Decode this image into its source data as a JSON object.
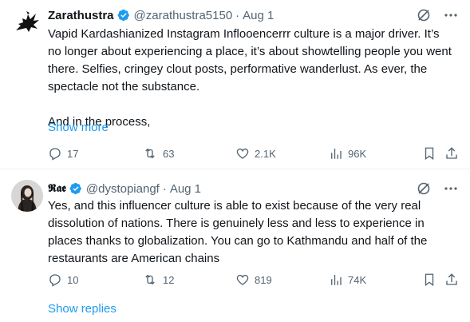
{
  "tweets": [
    {
      "name": "Zarathustra",
      "handle": "@zarathustra5150",
      "separator": "·",
      "date": "Aug 1",
      "body": [
        "Vapid Kardashianized Instagram Inflooencerrr  culture is a major driver. It’s no longer about experiencing a place, it’s about showtelling people you went there. Selfies, cringey clout posts, performative wanderlust. As ever, the spectacle not the substance.",
        "And in the process,"
      ],
      "show_more": "Show more",
      "stats": {
        "replies": "17",
        "retweets": "63",
        "likes": "2.1K",
        "views": "96K"
      }
    },
    {
      "name": "𝕽𝖆𝖊",
      "handle": "@dystopiangf",
      "separator": "·",
      "date": "Aug 1",
      "body": [
        "Yes, and this influencer culture is able to exist because of the very real dissolution of nations. There is genuinely less and less to experience in places thanks to globalization. You can go to Kathmandu and half of the restaurants are American chains"
      ],
      "stats": {
        "replies": "10",
        "retweets": "12",
        "likes": "819",
        "views": "74K"
      }
    }
  ],
  "show_replies": "Show replies",
  "colors": {
    "text": "#0f1419",
    "muted": "#536471",
    "accent": "#1d9bf0"
  },
  "icons": [
    "raven-avatar-icon",
    "verified-badge-icon",
    "grok-icon",
    "more-icon",
    "reply-icon",
    "retweet-icon",
    "like-icon",
    "views-icon",
    "bookmark-icon",
    "share-icon"
  ]
}
